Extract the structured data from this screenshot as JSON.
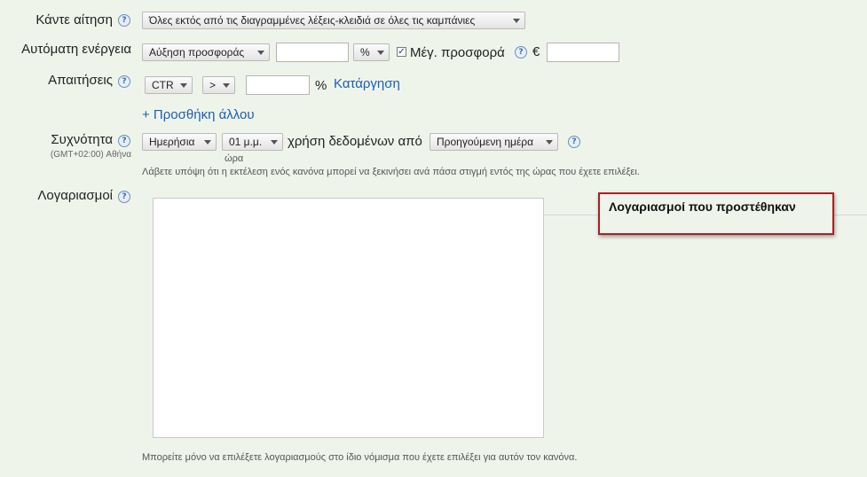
{
  "rows": {
    "action": {
      "label": "Κάντε αίτηση",
      "scope_value": "Όλες εκτός από τις διαγραμμένες λέξεις-κλειδιά σε όλες τις καμπάνιες"
    },
    "auto_action": {
      "label": "Αυτόματη ενέργεια",
      "action_value": "Αύξηση προσφοράς",
      "amount_value": "",
      "unit_value": "%",
      "max_bid_checked": true,
      "max_bid_label": "Μέγ. προσφορά",
      "currency": "€",
      "max_bid_value": ""
    },
    "requirements": {
      "label": "Απαιτήσεις",
      "metric_value": "CTR",
      "operator_value": ">",
      "threshold_value": "",
      "percent_sign": "%",
      "remove_link": "Κατάργηση",
      "add_more_link": "+ Προσθήκη άλλου"
    },
    "frequency": {
      "label": "Συχνότητα",
      "timezone": "(GMT+02:00) Αθήνα",
      "period_value": "Ημερήσια",
      "time_value": "01 μ.μ.",
      "time_caption": "ώρα",
      "data_usage_text": "χρήση δεδομένων από",
      "range_value": "Προηγούμενη ημέρα",
      "note": "Λάβετε υπόψη ότι η εκτέλεση ενός κανόνα μπορεί να ξεκινήσει ανά πάσα στιγμή εντός της ώρας που έχετε επιλέξει."
    },
    "accounts": {
      "label": "Λογαριασμοί",
      "added_header": "Λογαριασμοί που προστέθηκαν",
      "note": "Μπορείτε μόνο να επιλέξετε λογαριασμούς στο ίδιο νόμισμα που έχετε επιλέξει για αυτόν τον κανόνα."
    }
  },
  "help_glyph": "?",
  "icons": {
    "help": "help-icon",
    "dropdown": "chevron-down-icon",
    "checkbox": "check-icon"
  },
  "colors": {
    "background": "#eff4ea",
    "link": "#1a5fb4",
    "highlight_border": "#b01c24"
  }
}
